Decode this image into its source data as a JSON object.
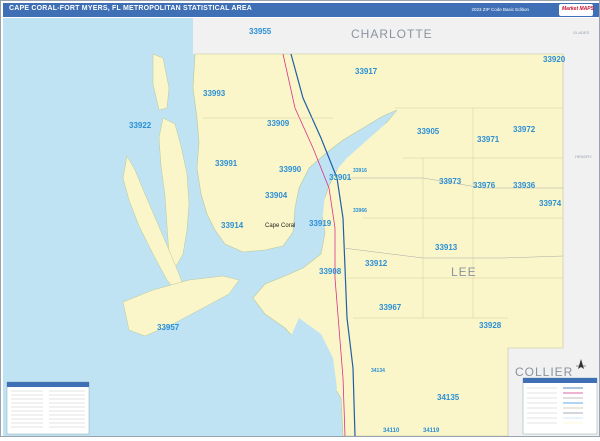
{
  "title": "CAPE CORAL-FORT MYERS, FL METROPOLITAN STATISTICAL AREA",
  "subtitle": "2023 ZIP Code Basic Edition",
  "logo": {
    "text": "Market MAPS",
    "icon": "map-logo-icon"
  },
  "counties": [
    {
      "name": "CHARLOTTE"
    },
    {
      "name": "LEE"
    },
    {
      "name": "COLLIER"
    },
    {
      "name": "GLADES"
    },
    {
      "name": "HENDRY"
    }
  ],
  "cities": [
    {
      "name": "Cape Coral"
    }
  ],
  "zips": [
    {
      "code": "33955"
    },
    {
      "code": "33917"
    },
    {
      "code": "33920"
    },
    {
      "code": "33993"
    },
    {
      "code": "33922"
    },
    {
      "code": "33909"
    },
    {
      "code": "33905"
    },
    {
      "code": "33971"
    },
    {
      "code": "33972"
    },
    {
      "code": "33991"
    },
    {
      "code": "33990"
    },
    {
      "code": "33904"
    },
    {
      "code": "33901"
    },
    {
      "code": "33916"
    },
    {
      "code": "33973"
    },
    {
      "code": "33976"
    },
    {
      "code": "33936"
    },
    {
      "code": "33974"
    },
    {
      "code": "33966"
    },
    {
      "code": "33914"
    },
    {
      "code": "33919"
    },
    {
      "code": "33913"
    },
    {
      "code": "33908"
    },
    {
      "code": "33912"
    },
    {
      "code": "33957"
    },
    {
      "code": "33967"
    },
    {
      "code": "33928"
    },
    {
      "code": "34134"
    },
    {
      "code": "34135"
    },
    {
      "code": "34110"
    },
    {
      "code": "34119"
    }
  ],
  "colors": {
    "land": "#fbf6c9",
    "water": "#bfe3f2",
    "title_bar": "#3f6fb4",
    "zip_label": "#2b8fd6",
    "county_label": "#8a949e",
    "outside_area": "#f1f1f1",
    "interstate": "#1f5fa8",
    "highway": "#d8328a"
  }
}
